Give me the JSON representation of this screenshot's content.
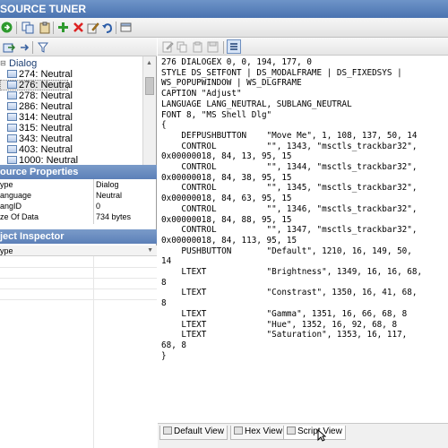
{
  "app": {
    "title": "SOURCE TUNER"
  },
  "toolbar": {
    "icons": [
      "green-arrow-icon",
      "copy-icon",
      "paste-icon",
      "add-icon",
      "delete-icon",
      "edit-icon",
      "undo-icon",
      "page-icon"
    ]
  },
  "left_toolbar": {
    "icons": [
      "export-icon",
      "arrow-icon",
      "filter-icon"
    ]
  },
  "tree": {
    "root": "Dialog",
    "items": [
      "274: Neutral",
      "276: Neutral",
      "278: Neutral",
      "286: Neutral",
      "314: Neutral",
      "315: Neutral",
      "343: Neutral",
      "403: Neutral",
      "1000: Neutral"
    ]
  },
  "source_properties": {
    "header": "ource Properties",
    "rows": [
      {
        "key": "ype",
        "value": "Dialog"
      },
      {
        "key": "anguage",
        "value": "Neutral"
      },
      {
        "key": "angID",
        "value": "0"
      },
      {
        "key": "ze Of Data",
        "value": "734 bytes"
      }
    ]
  },
  "object_inspector": {
    "header": "ject Inspector",
    "type_label": "ype"
  },
  "script": {
    "lines": [
      "276 DIALOGEX 0, 0, 194, 177, 0",
      "STYLE DS_SETFONT | DS_MODALFRAME | DS_FIXEDSYS |",
      "WS_POPUPWINDOW | WS_DLGFRAME",
      "CAPTION \"Adjust\"",
      "LANGUAGE LANG_NEUTRAL, SUBLANG_NEUTRAL",
      "FONT 8, \"MS Shell Dlg\"",
      "{",
      "    DEFPUSHBUTTON    \"Move Me\", 1, 108, 137, 50, 14",
      "    CONTROL          \"\", 1343, \"msctls_trackbar32\",",
      "0x00000018, 84, 13, 95, 15",
      "    CONTROL          \"\", 1344, \"msctls_trackbar32\",",
      "0x00000018, 84, 38, 95, 15",
      "    CONTROL          \"\", 1345, \"msctls_trackbar32\",",
      "0x00000018, 84, 63, 95, 15",
      "    CONTROL          \"\", 1346, \"msctls_trackbar32\",",
      "0x00000018, 84, 88, 95, 15",
      "    CONTROL          \"\", 1347, \"msctls_trackbar32\",",
      "0x00000018, 84, 113, 95, 15",
      "    PUSHBUTTON       \"Default\", 1210, 16, 149, 50,",
      "14",
      "    LTEXT            \"Brightness\", 1349, 16, 16, 68,",
      "8",
      "    LTEXT            \"Constrast\", 1350, 16, 41, 68,",
      "8",
      "    LTEXT            \"Gamma\", 1351, 16, 66, 68, 8",
      "    LTEXT            \"Hue\", 1352, 16, 92, 68, 8",
      "    LTEXT            \"Saturation\", 1353, 16, 117,",
      "68, 8",
      "}"
    ]
  },
  "tabs": [
    {
      "label": "Default View"
    },
    {
      "label": "Hex View"
    },
    {
      "label": "Script View",
      "active": true
    }
  ],
  "colors": {
    "header_blue": "#5c80b8",
    "title_blue": "#4a73b0"
  }
}
